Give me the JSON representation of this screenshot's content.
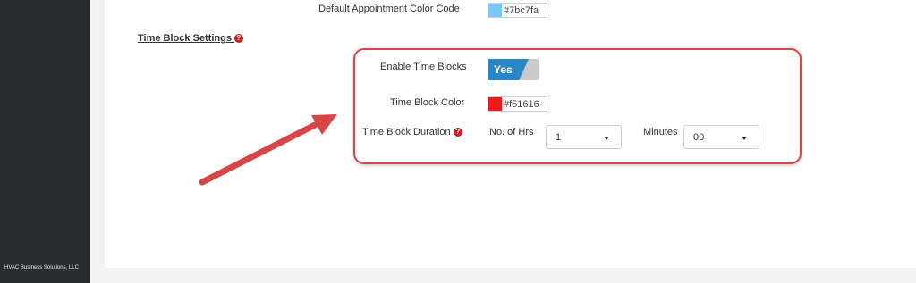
{
  "sidebar": {
    "footer_text": "HVAC Business Solutions, LLC"
  },
  "settings": {
    "default_appointment_color": {
      "label": "Default Appointment Color Code",
      "value": "#7bc7fa",
      "color": "#7bc7fa"
    },
    "time_block_section": {
      "title": "Time Block Settings",
      "help_icon": "question-circle-icon",
      "enable_time_blocks": {
        "label": "Enable Time Blocks",
        "value": "Yes",
        "on_color": "#2b86c5",
        "off_color": "#c9c9c9"
      },
      "time_block_color": {
        "label": "Time Block Color",
        "value": "#f51616",
        "color": "#f51616"
      },
      "time_block_duration": {
        "label": "Time Block Duration",
        "help_icon": "question-circle-icon",
        "hours_label": "No. of Hrs",
        "hours_value": "1",
        "minutes_label": "Minutes",
        "minutes_value": "00"
      }
    }
  },
  "annotation": {
    "color": "#d84545",
    "arrow_icon": "annotation-arrow-icon"
  }
}
